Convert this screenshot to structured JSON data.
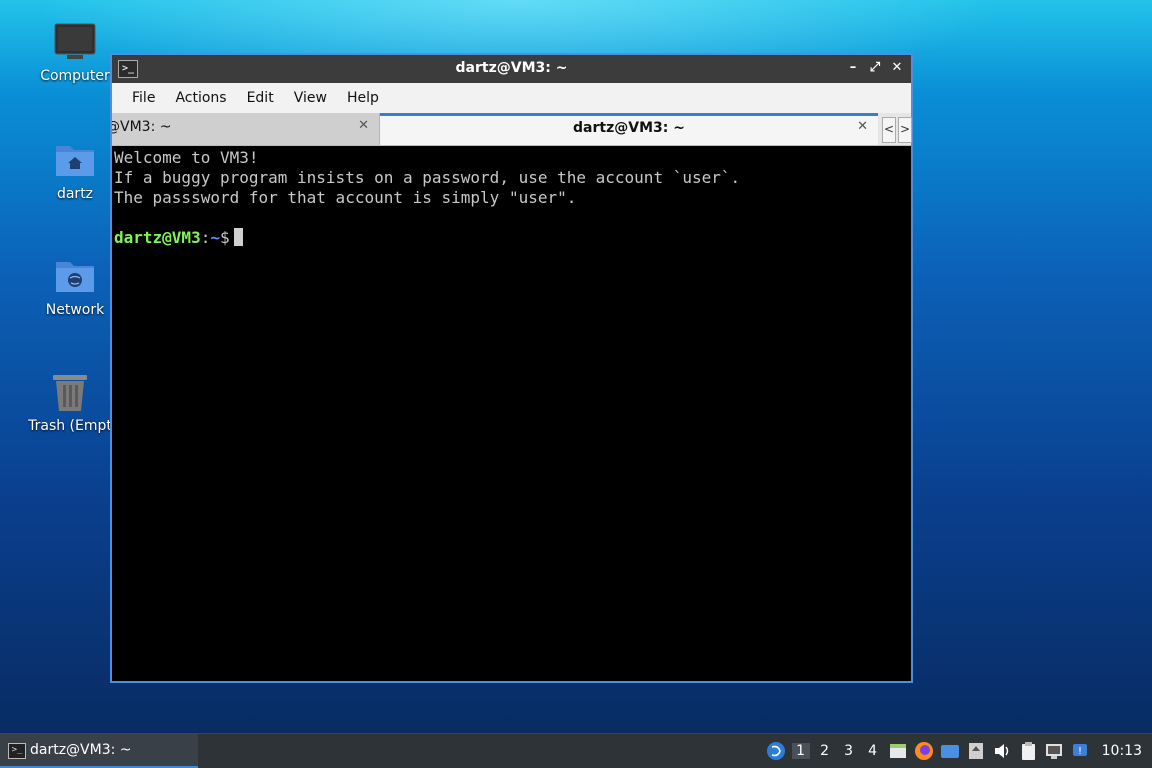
{
  "desktop": {
    "icons": [
      {
        "label": "Computer"
      },
      {
        "label": "dartz"
      },
      {
        "label": "Network"
      },
      {
        "label": "Trash (Empt"
      }
    ]
  },
  "window": {
    "title": "dartz@VM3: ~",
    "buttons": {
      "minimize": "–",
      "maximize": "⤢",
      "close": "✕"
    },
    "menu": [
      "File",
      "Actions",
      "Edit",
      "View",
      "Help"
    ],
    "tabs": [
      {
        "label": "@VM3: ~",
        "active": false
      },
      {
        "label": "dartz@VM3: ~",
        "active": true
      }
    ],
    "tab_scroll": {
      "left": "<",
      "right": ">"
    }
  },
  "terminal": {
    "lines": [
      "Welcome to VM3!",
      "If a buggy program insists on a password, use the account `user`.",
      "The passsword for that account is simply \"user\"."
    ],
    "prompt": {
      "user_host": "dartz@VM3",
      "separator": ":",
      "path": "~",
      "symbol": "$"
    }
  },
  "taskbar": {
    "task": {
      "label": "dartz@VM3: ~"
    },
    "workspaces": [
      "1",
      "2",
      "3",
      "4"
    ],
    "current_workspace": "1",
    "tray_icons": [
      "lxqt-menu-icon",
      "file-manager-icon",
      "firefox-icon",
      "desktop-icon",
      "upload-icon",
      "volume-icon",
      "clipboard-icon",
      "network-icon",
      "notification-icon"
    ],
    "clock": "10:13"
  },
  "colors": {
    "accent": "#3a7bd5",
    "prompt_user": "#7ef554",
    "prompt_path": "#6b8cff"
  }
}
